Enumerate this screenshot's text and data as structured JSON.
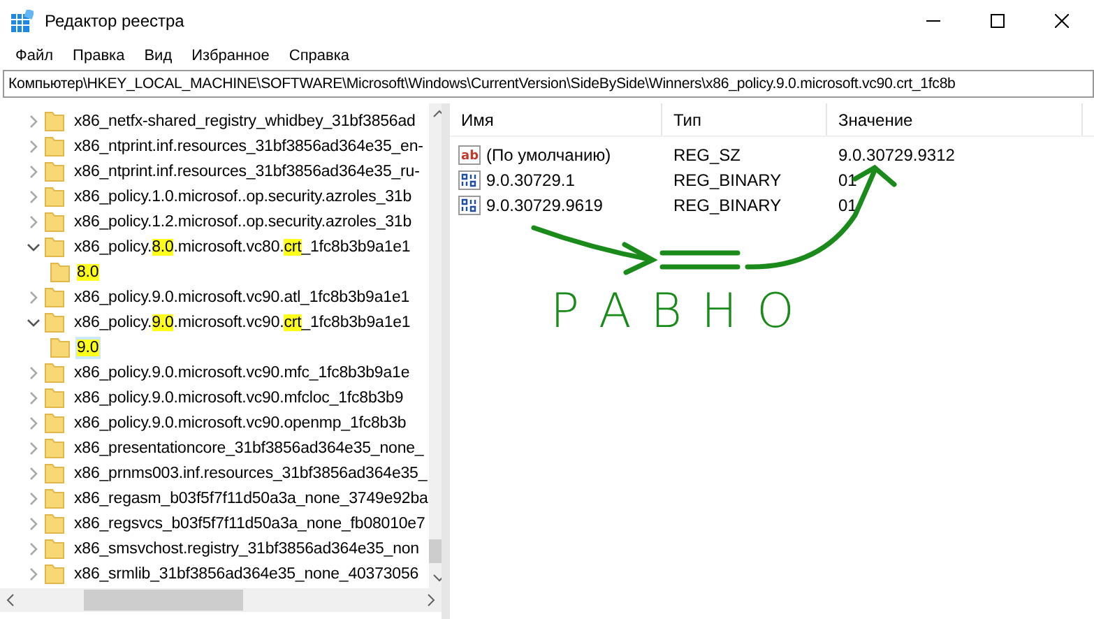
{
  "window": {
    "title": "Редактор реестра"
  },
  "menu": [
    "Файл",
    "Правка",
    "Вид",
    "Избранное",
    "Справка"
  ],
  "address": "Компьютер\\HKEY_LOCAL_MACHINE\\SOFTWARE\\Microsoft\\Windows\\CurrentVersion\\SideBySide\\Winners\\x86_policy.9.0.microsoft.vc90.crt_1fc8b",
  "tree": [
    {
      "expanded": false,
      "segments": [
        {
          "text": "x86_netfx-shared_registry_whidbey_31bf3856ad"
        }
      ]
    },
    {
      "expanded": false,
      "segments": [
        {
          "text": "x86_ntprint.inf.resources_31bf3856ad364e35_en-"
        }
      ]
    },
    {
      "expanded": false,
      "segments": [
        {
          "text": "x86_ntprint.inf.resources_31bf3856ad364e35_ru-"
        }
      ]
    },
    {
      "expanded": false,
      "segments": [
        {
          "text": "x86_policy.1.0.microsof..op.security.azroles_31b"
        }
      ]
    },
    {
      "expanded": false,
      "segments": [
        {
          "text": "x86_policy.1.2.microsof..op.security.azroles_31b"
        }
      ]
    },
    {
      "expanded": true,
      "segments": [
        {
          "text": "x86_policy."
        },
        {
          "text": "8.0",
          "highlighted": true
        },
        {
          "text": ".microsoft.vc80."
        },
        {
          "text": "crt",
          "highlighted": true
        },
        {
          "text": "_1fc8b3b9a1e1"
        }
      ],
      "children": [
        {
          "selected": false,
          "segments": [
            {
              "text": "8.0",
              "highlighted": true
            }
          ]
        }
      ]
    },
    {
      "expanded": false,
      "segments": [
        {
          "text": "x86_policy.9.0.microsoft.vc90.atl_1fc8b3b9a1e1"
        }
      ]
    },
    {
      "expanded": true,
      "segments": [
        {
          "text": "x86_policy."
        },
        {
          "text": "9.0",
          "highlighted": true
        },
        {
          "text": ".microsoft.vc90."
        },
        {
          "text": "crt",
          "highlighted": true
        },
        {
          "text": "_1fc8b3b9a1e1"
        }
      ],
      "children": [
        {
          "selected": true,
          "segments": [
            {
              "text": "9.0",
              "highlighted": true
            }
          ]
        }
      ]
    },
    {
      "expanded": false,
      "segments": [
        {
          "text": "x86_policy.9.0.microsoft.vc90.mfc_1fc8b3b9a1e"
        }
      ]
    },
    {
      "expanded": false,
      "segments": [
        {
          "text": "x86_policy.9.0.microsoft.vc90.mfcloc_1fc8b3b9"
        }
      ]
    },
    {
      "expanded": false,
      "segments": [
        {
          "text": "x86_policy.9.0.microsoft.vc90.openmp_1fc8b3b"
        }
      ]
    },
    {
      "expanded": false,
      "segments": [
        {
          "text": "x86_presentationcore_31bf3856ad364e35_none_"
        }
      ]
    },
    {
      "expanded": false,
      "segments": [
        {
          "text": "x86_prnms003.inf.resources_31bf3856ad364e35_"
        }
      ]
    },
    {
      "expanded": false,
      "segments": [
        {
          "text": "x86_regasm_b03f5f7f11d50a3a_none_3749e92ba"
        }
      ]
    },
    {
      "expanded": false,
      "segments": [
        {
          "text": "x86_regsvcs_b03f5f7f11d50a3a_none_fb08010e7"
        }
      ]
    },
    {
      "expanded": false,
      "segments": [
        {
          "text": "x86_smsvchost.registry_31bf3856ad364e35_non"
        }
      ]
    },
    {
      "expanded": false,
      "segments": [
        {
          "text": "x86_srmlib_31bf3856ad364e35_none_40373056"
        }
      ]
    }
  ],
  "table": {
    "columns": [
      "Имя",
      "Тип",
      "Значение"
    ],
    "rows": [
      {
        "kind": "string",
        "icon_label": "ab",
        "name": "(По умолчанию)",
        "type": "REG_SZ",
        "value": "9.0.30729.9312"
      },
      {
        "kind": "binary",
        "name": "9.0.30729.1",
        "type": "REG_BINARY",
        "value": "01"
      },
      {
        "kind": "binary",
        "name": "9.0.30729.9619",
        "type": "REG_BINARY",
        "value": "01"
      }
    ]
  },
  "annotation": {
    "text": "РАВНО"
  }
}
